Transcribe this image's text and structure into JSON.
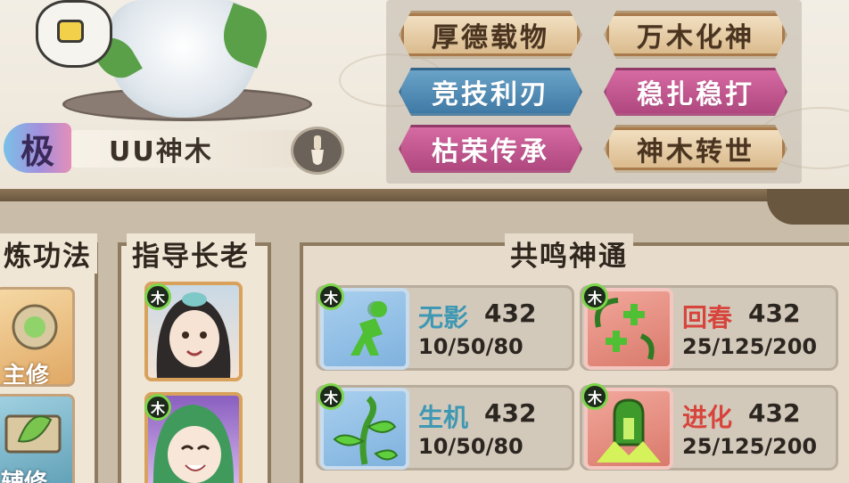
{
  "character": {
    "grade": "极",
    "name": "UU神木",
    "brush_icon": "brush-icon"
  },
  "tags": [
    {
      "label": "厚德载物",
      "style": "brown"
    },
    {
      "label": "万木化神",
      "style": "brown"
    },
    {
      "label": "竞技利刃",
      "style": "blue"
    },
    {
      "label": "稳扎稳打",
      "style": "pink"
    },
    {
      "label": "枯荣传承",
      "style": "pink"
    },
    {
      "label": "神木转世",
      "style": "brown"
    }
  ],
  "panels": {
    "technique_title": "炼功法",
    "technique_main": "主修",
    "technique_aux": "辅修",
    "elder_title": "指导长老",
    "elder_badge": "木",
    "resonance_title": "共鸣神通"
  },
  "skills": [
    {
      "name": "无影",
      "value": "432",
      "nums": "10/50/80",
      "badge": "木",
      "name_color": "teal",
      "icon": "running-figure-icon"
    },
    {
      "name": "回春",
      "value": "432",
      "nums": "25/125/200",
      "badge": "木",
      "name_color": "red",
      "icon": "heal-plus-icon"
    },
    {
      "name": "生机",
      "value": "432",
      "nums": "10/50/80",
      "badge": "木",
      "name_color": "teal",
      "icon": "vine-sprout-icon"
    },
    {
      "name": "进化",
      "value": "432",
      "nums": "25/125/200",
      "badge": "木",
      "name_color": "red",
      "icon": "evolve-burst-icon"
    }
  ]
}
